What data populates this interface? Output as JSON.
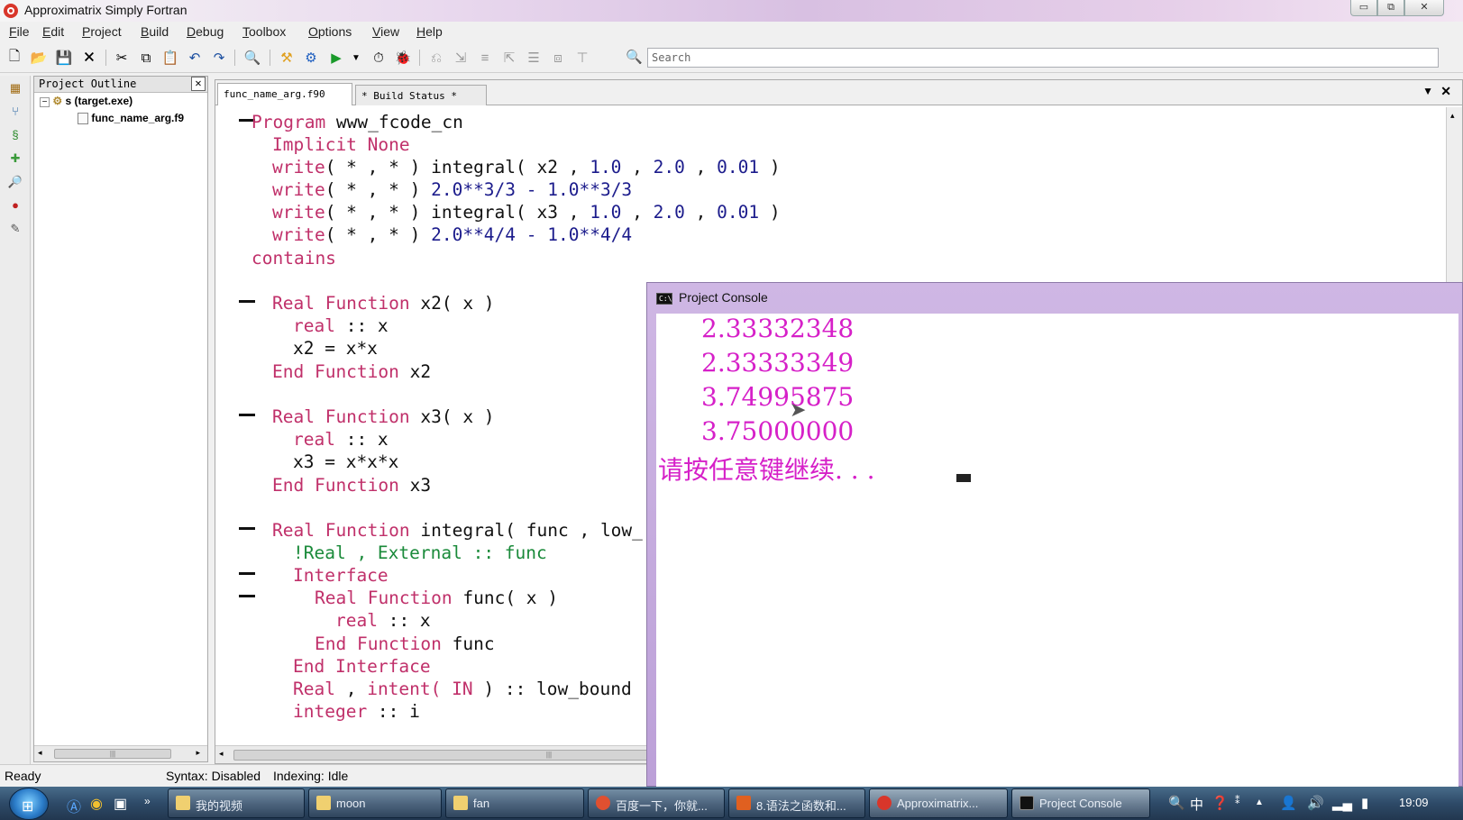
{
  "window": {
    "title": "Approximatrix Simply Fortran",
    "min_glyph": "▭",
    "max_glyph": "⧉",
    "close_glyph": "✕"
  },
  "menu": [
    "File",
    "Edit",
    "Project",
    "Build",
    "Debug",
    "Toolbox",
    "Options",
    "View",
    "Help"
  ],
  "search": {
    "placeholder": "Search"
  },
  "outline": {
    "title": "Project Outline",
    "close_glyph": "✕",
    "root": "s (target.exe)",
    "file": "func_name_arg.f9"
  },
  "tabs": {
    "file": "func_name_arg.f90",
    "build": "* Build Status *",
    "dropdown_glyph": "▼",
    "close_glyph": "✕"
  },
  "code": {
    "l1": {
      "kw": "Program",
      "rest": " www_fcode_cn"
    },
    "l2": {
      "kw": "Implicit None"
    },
    "l3": {
      "kw": "write",
      "rest": "( * , * ) integral( x2 , ",
      "n1": "1.0",
      "s1": " , ",
      "n2": "2.0",
      "s2": " , ",
      "n3": "0.01",
      "s3": " )"
    },
    "l4": {
      "kw": "write",
      "rest": "( * , * ) ",
      "e1": "2.0**3/3 - 1.0**3/3"
    },
    "l5": {
      "kw": "write",
      "rest": "( * , * ) integral( x3 , ",
      "n1": "1.0",
      "s1": " , ",
      "n2": "2.0",
      "s2": " , ",
      "n3": "0.01",
      "s3": " )"
    },
    "l6": {
      "kw": "write",
      "rest": "( * , * ) ",
      "e1": "2.0**4/4 - 1.0**4/4"
    },
    "l7": {
      "kw": "contains"
    },
    "l9": {
      "kw": "Real Function",
      "rest": " x2( x )"
    },
    "l10": {
      "kw": "real",
      "rest": " :: x"
    },
    "l11": {
      "rest": "x2 = x*x"
    },
    "l12": {
      "kw": "End Function",
      "rest": " x2"
    },
    "l14": {
      "kw": "Real Function",
      "rest": " x3( x )"
    },
    "l15": {
      "kw": "real",
      "rest": " :: x"
    },
    "l16": {
      "rest": "x3 = x*x*x"
    },
    "l17": {
      "kw": "End Function",
      "rest": " x3"
    },
    "l19": {
      "kw": "Real Function",
      "rest": " integral( func , low_"
    },
    "l20": {
      "kw": "!Real , External :: func"
    },
    "l21": {
      "kw": "Interface"
    },
    "l22": {
      "kw": "Real Function",
      "rest": " func( x )"
    },
    "l23": {
      "kw": "real",
      "rest": " :: x"
    },
    "l24": {
      "kw": "End Function",
      "rest": " func"
    },
    "l25": {
      "kw": "End Interface"
    },
    "l26": {
      "kw": "Real",
      "rest": " , ",
      "kw2": "intent(",
      "rest2": " IN ",
      "rest3": ") :: low_bound"
    },
    "l27": {
      "kw": "integer",
      "rest": " :: i"
    }
  },
  "status": {
    "ready": "Ready",
    "syntax": "Syntax: Disabled",
    "indexing": "Indexing: Idle"
  },
  "console": {
    "title": "Project Console",
    "icon_text": "C:\\",
    "lines": [
      "2.33332348",
      "2.33333349",
      "3.74995875",
      "3.75000000"
    ],
    "prompt": "请按任意键继续. . ."
  },
  "taskbar": {
    "tasks": [
      "我的视频",
      "moon",
      "fan",
      "百度一下，你就...",
      "8.语法之函数和...",
      "Approximatrix...",
      "Project Console"
    ],
    "tray_ime": "中",
    "clock": "19:09"
  }
}
